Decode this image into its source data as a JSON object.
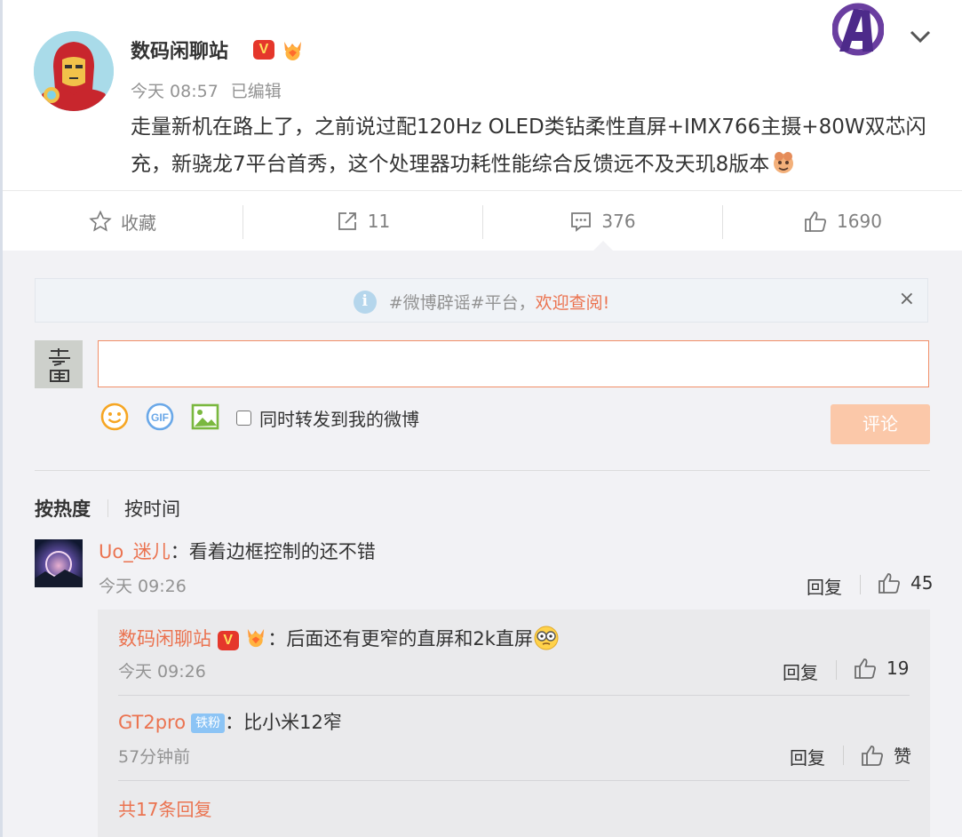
{
  "post": {
    "author": "数码闲聊站",
    "verified_badge": "V",
    "time": "今天 08:57",
    "edited": "已编辑",
    "content": "走量新机在路上了，之前说过配120Hz OLED类钻柔性直屏+IMX766主摄+80W双芯闪充，新骁龙7平台首秀，这个处理器功耗性能综合反馈远不及天玑8版本"
  },
  "actions": {
    "favorite_label": "收藏",
    "repost_count": "11",
    "comment_count": "376",
    "like_count": "1690"
  },
  "notice": {
    "text_prefix": "#微博辟谣#平台，",
    "text_highlight": "欢迎查阅!",
    "close": "×"
  },
  "composer": {
    "placeholder": "",
    "also_repost_label": "同时转发到我的微博",
    "submit_label": "评论",
    "gif_label": "GIF"
  },
  "sort": {
    "hot": "按热度",
    "time": "按时间"
  },
  "comments": [
    {
      "user": "Uo_迷儿",
      "sep": "：",
      "text": "看着边框控制的还不错",
      "time": "今天 09:26",
      "reply_label": "回复",
      "likes": "45",
      "replies": [
        {
          "user": "数码闲聊站",
          "sep": "：",
          "text": "后面还有更窄的直屏和2k直屏",
          "time": "今天 09:26",
          "reply_label": "回复",
          "likes": "19"
        },
        {
          "user": "GT2pro",
          "badge": "铁粉",
          "sep": "：",
          "text": "比小米12窄",
          "time": "57分钟前",
          "reply_label": "回复",
          "likes": "赞"
        }
      ],
      "more_replies": "共17条回复"
    }
  ],
  "colors": {
    "accent": "#eb7350",
    "submit_disabled": "#fbc8a9",
    "muted": "#939393",
    "panel_bg": "#f2f2f5"
  },
  "icons": [
    "avengers-logo-icon",
    "chevron-down-icon",
    "star-icon",
    "repost-icon",
    "comment-icon",
    "thumbs-up-icon",
    "info-icon",
    "close-icon",
    "smiley-icon",
    "gif-icon",
    "image-icon",
    "medal-icon"
  ]
}
